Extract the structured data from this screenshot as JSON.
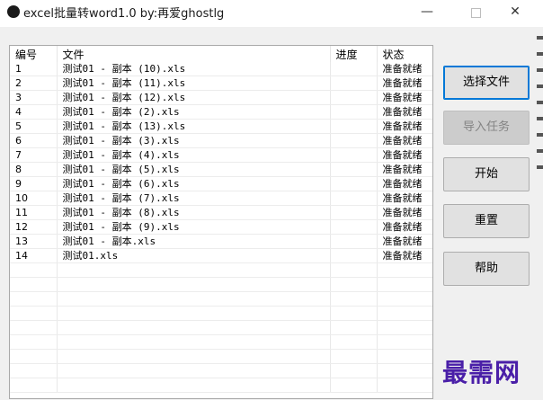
{
  "window": {
    "title": "excel批量转word1.0  by:再爱ghostlg",
    "minimize_glyph": "—",
    "close_glyph": "✕"
  },
  "table": {
    "columns": [
      "编号",
      "文件",
      "进度",
      "状态"
    ],
    "rows": [
      {
        "num": "1",
        "file": "测试01 - 副本 (10).xls",
        "progress": "",
        "status": "准备就绪"
      },
      {
        "num": "2",
        "file": "测试01 - 副本 (11).xls",
        "progress": "",
        "status": "准备就绪"
      },
      {
        "num": "3",
        "file": "测试01 - 副本 (12).xls",
        "progress": "",
        "status": "准备就绪"
      },
      {
        "num": "4",
        "file": "测试01 - 副本 (2).xls",
        "progress": "",
        "status": "准备就绪"
      },
      {
        "num": "5",
        "file": "测试01 - 副本 (13).xls",
        "progress": "",
        "status": "准备就绪"
      },
      {
        "num": "6",
        "file": "测试01 - 副本 (3).xls",
        "progress": "",
        "status": "准备就绪"
      },
      {
        "num": "7",
        "file": "测试01 - 副本 (4).xls",
        "progress": "",
        "status": "准备就绪"
      },
      {
        "num": "8",
        "file": "测试01 - 副本 (5).xls",
        "progress": "",
        "status": "准备就绪"
      },
      {
        "num": "9",
        "file": "测试01 - 副本 (6).xls",
        "progress": "",
        "status": "准备就绪"
      },
      {
        "num": "10",
        "file": "测试01 - 副本 (7).xls",
        "progress": "",
        "status": "准备就绪"
      },
      {
        "num": "11",
        "file": "测试01 - 副本 (8).xls",
        "progress": "",
        "status": "准备就绪"
      },
      {
        "num": "12",
        "file": "测试01 - 副本 (9).xls",
        "progress": "",
        "status": "准备就绪"
      },
      {
        "num": "13",
        "file": "测试01 - 副本.xls",
        "progress": "",
        "status": "准备就绪"
      },
      {
        "num": "14",
        "file": "测试01.xls",
        "progress": "",
        "status": "准备就绪"
      }
    ],
    "empty_rows": 9
  },
  "buttons": {
    "select_file": "选择文件",
    "import_task": "导入任务",
    "start": "开始",
    "reset": "重置",
    "help": "帮助"
  },
  "watermark": "最需网",
  "colors": {
    "accent": "#0078d7",
    "watermark": "#4a1fa8"
  }
}
